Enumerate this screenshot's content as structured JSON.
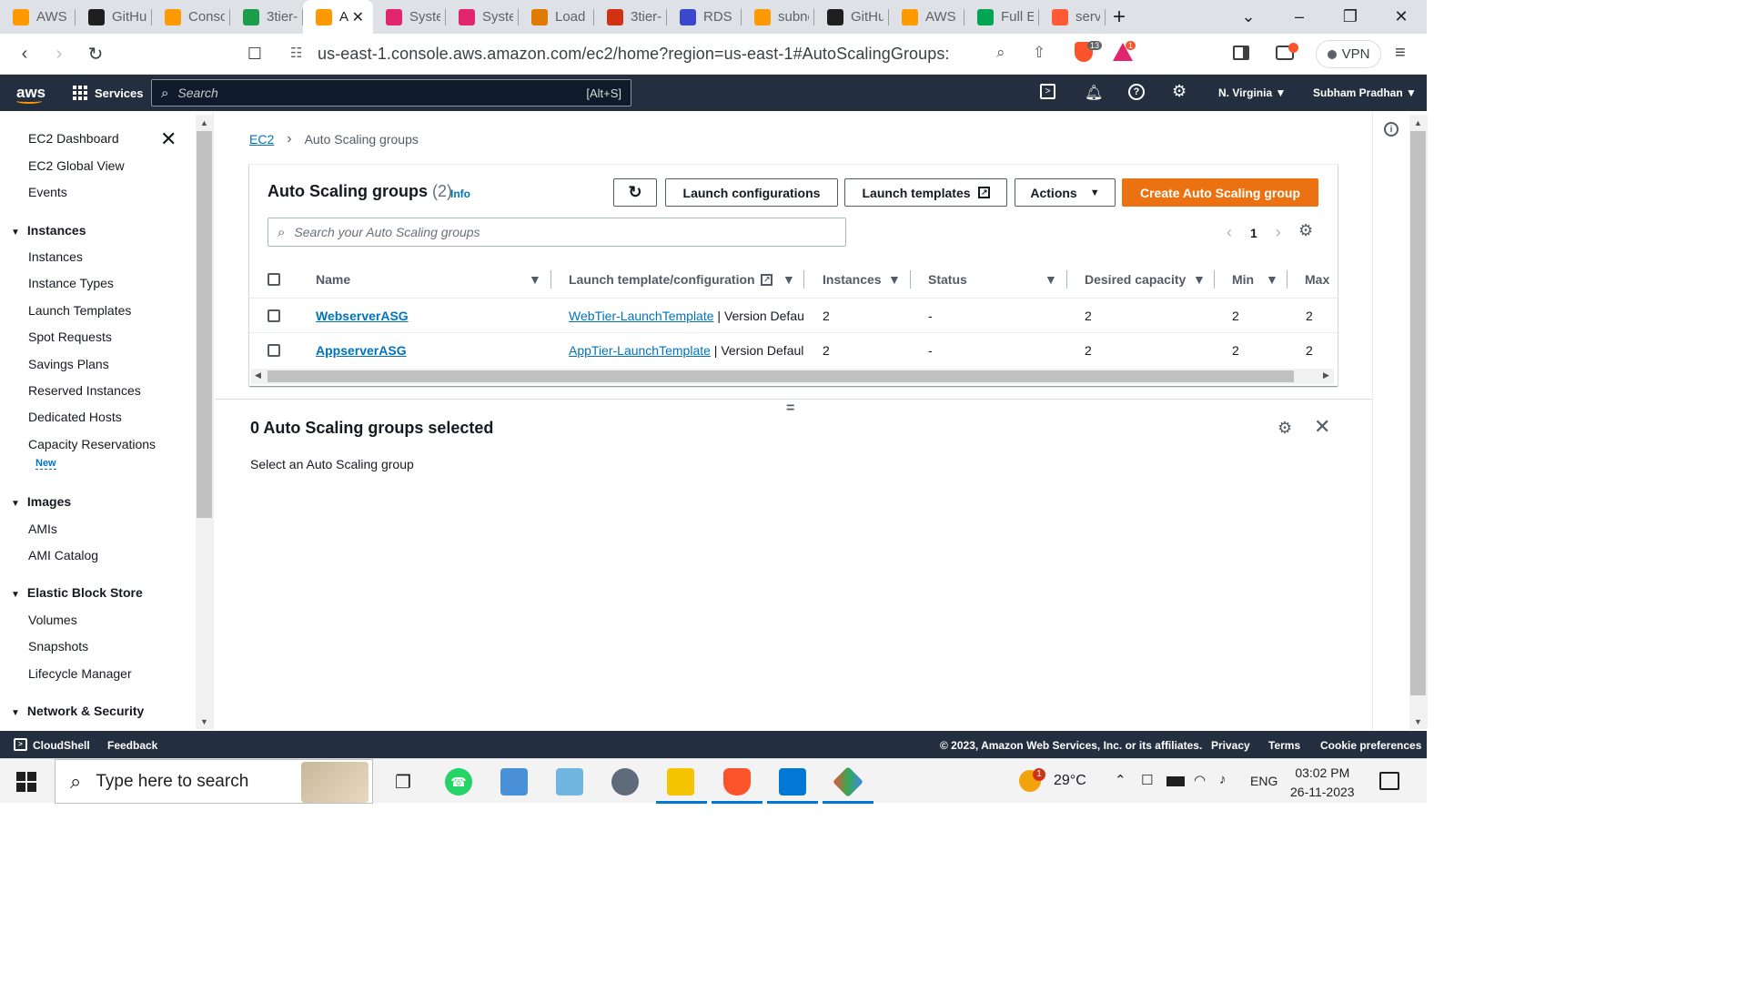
{
  "browser": {
    "tabs": [
      {
        "label": "AWS",
        "icon": "aws-box-icon",
        "color": "#ff9900"
      },
      {
        "label": "GitHu",
        "icon": "github-icon",
        "color": "#1f1f1f"
      },
      {
        "label": "Consc",
        "icon": "aws-box-icon",
        "color": "#ff9900"
      },
      {
        "label": "3tier-",
        "icon": "green-square-icon",
        "color": "#1b9e4b"
      },
      {
        "label": "A",
        "icon": "aws-orange-icon",
        "color": "#ff9900",
        "active": true
      },
      {
        "label": "Syster",
        "icon": "pink-icon",
        "color": "#e0266f"
      },
      {
        "label": "Syster",
        "icon": "pink-icon",
        "color": "#e0266f"
      },
      {
        "label": "Load",
        "icon": "orange-icon",
        "color": "#e07b00"
      },
      {
        "label": "3tier-",
        "icon": "red-icon",
        "color": "#d13212"
      },
      {
        "label": "RDS",
        "icon": "blue-icon",
        "color": "#3b48cc"
      },
      {
        "label": "subne",
        "icon": "aws-box-icon",
        "color": "#ff9900"
      },
      {
        "label": "GitHu",
        "icon": "github-icon",
        "color": "#1f1f1f"
      },
      {
        "label": "AWS",
        "icon": "aws-box-icon",
        "color": "#ff9900"
      },
      {
        "label": "Full E",
        "icon": "n-icon",
        "color": "#00a651"
      },
      {
        "label": "server",
        "icon": "ask-icon",
        "color": "#ff5a36"
      }
    ],
    "url": "us-east-1.console.aws.amazon.com/ec2/home?region=us-east-1#AutoScalingGroups:",
    "brave_badge": "13",
    "alert_badge": "1",
    "vpn_label": "VPN"
  },
  "aws_nav": {
    "logo": "aws",
    "services_label": "Services",
    "search_placeholder": "Search",
    "search_shortcut": "[Alt+S]",
    "region": "N. Virginia ▼",
    "user": "Subham Pradhan ▼"
  },
  "sidebar": {
    "top_links": [
      "EC2 Dashboard",
      "EC2 Global View",
      "Events"
    ],
    "sections": [
      {
        "title": "Instances",
        "items": [
          "Instances",
          "Instance Types",
          "Launch Templates",
          "Spot Requests",
          "Savings Plans",
          "Reserved Instances",
          "Dedicated Hosts",
          "Capacity Reservations"
        ]
      },
      {
        "title": "Images",
        "items": [
          "AMIs",
          "AMI Catalog"
        ]
      },
      {
        "title": "Elastic Block Store",
        "items": [
          "Volumes",
          "Snapshots",
          "Lifecycle Manager"
        ]
      },
      {
        "title": "Network & Security",
        "items": []
      }
    ],
    "new_badge": "New"
  },
  "breadcrumb": {
    "root": "EC2",
    "current": "Auto Scaling groups"
  },
  "panel": {
    "title": "Auto Scaling groups",
    "count": "(2)",
    "info": "Info",
    "buttons": {
      "launch_configurations": "Launch configurations",
      "launch_templates": "Launch templates",
      "actions": "Actions",
      "create": "Create Auto Scaling group"
    },
    "search_placeholder": "Search your Auto Scaling groups",
    "page": "1"
  },
  "table": {
    "columns": [
      "Name",
      "Launch template/configuration",
      "Instances",
      "Status",
      "Desired capacity",
      "Min",
      "Max"
    ],
    "rows": [
      {
        "name": "WebserverASG",
        "template": "WebTier-LaunchTemplate",
        "version": " | Version Defau",
        "instances": "2",
        "status": "-",
        "desired": "2",
        "min": "2",
        "max": "2"
      },
      {
        "name": "AppserverASG",
        "template": "AppTier-LaunchTemplate",
        "version": " | Version Defaul",
        "instances": "2",
        "status": "-",
        "desired": "2",
        "min": "2",
        "max": "2"
      }
    ]
  },
  "split_panel": {
    "title": "0 Auto Scaling groups selected",
    "body": "Select an Auto Scaling group",
    "handle": "="
  },
  "footer": {
    "cloudshell": "CloudShell",
    "feedback": "Feedback",
    "copyright": "© 2023, Amazon Web Services, Inc. or its affiliates.",
    "privacy": "Privacy",
    "terms": "Terms",
    "cookies": "Cookie preferences"
  },
  "taskbar": {
    "search_placeholder": "Type here to search",
    "weather": "29°C",
    "weather_badge": "1",
    "lang": "ENG",
    "time": "03:02 PM",
    "date": "26-11-2023"
  }
}
